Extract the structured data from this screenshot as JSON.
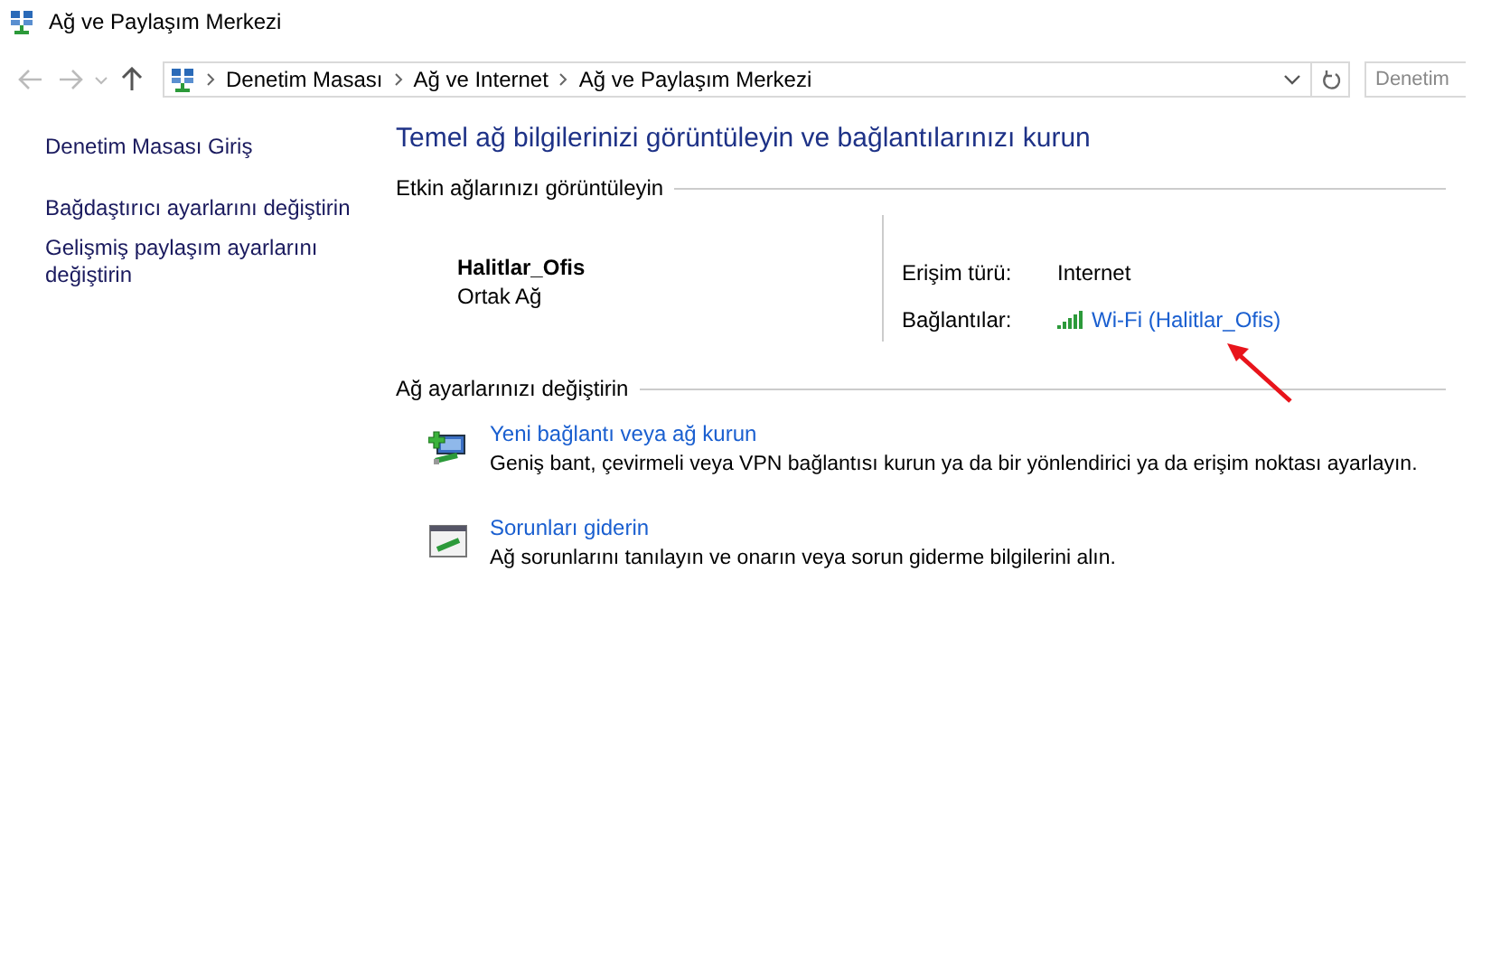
{
  "window": {
    "title": "Ağ ve Paylaşım Merkezi"
  },
  "navbar": {
    "breadcrumb": [
      "Denetim Masası",
      "Ağ ve Internet",
      "Ağ ve Paylaşım Merkezi"
    ],
    "search": {
      "placeholder": "Denetim"
    }
  },
  "sidebar": {
    "items": [
      {
        "label": "Denetim Masası Giriş",
        "kind": "home"
      },
      {
        "label": "Bağdaştırıcı ayarlarını değiştirin",
        "kind": "task"
      },
      {
        "label": "Gelişmiş paylaşım ayarlarını değiştirin",
        "kind": "task"
      }
    ]
  },
  "main": {
    "title": "Temel ağ bilgilerinizi görüntüleyin ve bağlantılarınızı kurun",
    "active_networks": {
      "heading": "Etkin ağlarınızı görüntüleyin",
      "network_name": "Halitlar_Ofis",
      "network_type": "Ortak Ağ",
      "access_label": "Erişim türü:",
      "access_value": "Internet",
      "connections_label": "Bağlantılar:",
      "connection_link": "Wi-Fi (Halitlar_Ofis)"
    },
    "change_settings": {
      "heading": "Ağ ayarlarınızı değiştirin",
      "tasks": [
        {
          "kind": "new-connection",
          "link": "Yeni bağlantı veya ağ kurun",
          "description": "Geniş bant, çevirmeli veya VPN bağlantısı kurun ya da bir yönlendirici ya da erişim noktası ayarlayın."
        },
        {
          "kind": "troubleshoot",
          "link": "Sorunları giderin",
          "description": "Ağ sorunlarını tanılayın ve onarın veya sorun giderme bilgilerini alın."
        }
      ]
    }
  }
}
